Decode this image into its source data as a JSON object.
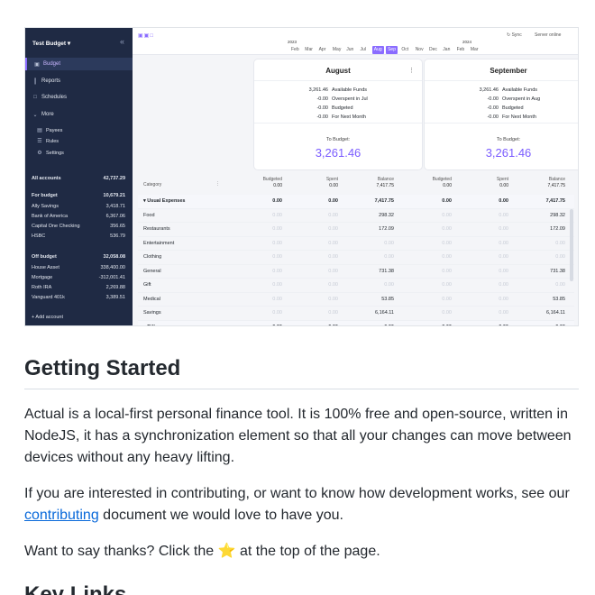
{
  "screenshot": {
    "sidebar": {
      "budget_title": "Test Budget ▾",
      "collapse_icon": "«",
      "nav": [
        {
          "icon": "wallet-icon",
          "glyph": "▣",
          "label": "Budget"
        },
        {
          "icon": "bar-chart-icon",
          "glyph": "┃",
          "label": "Reports"
        },
        {
          "icon": "calendar-icon",
          "glyph": "□",
          "label": "Schedules"
        },
        {
          "icon": "chevron-down-icon",
          "glyph": "⌄",
          "label": "More"
        },
        {
          "icon": "payees-icon",
          "glyph": "▤",
          "label": "Payees"
        },
        {
          "icon": "rules-icon",
          "glyph": "☰",
          "label": "Rules"
        },
        {
          "icon": "gear-icon",
          "glyph": "⚙",
          "label": "Settings"
        }
      ],
      "all_accounts": {
        "name": "All accounts",
        "amount": "42,737.29"
      },
      "for_budget": {
        "name": "For budget",
        "amount": "10,679.21"
      },
      "budget_accounts": [
        {
          "name": "Ally Savings",
          "amount": "3,418.71"
        },
        {
          "name": "Bank of America",
          "amount": "6,367.06"
        },
        {
          "name": "Capital One Checking",
          "amount": "356.65"
        },
        {
          "name": "HSBC",
          "amount": "536.79"
        }
      ],
      "off_budget": {
        "name": "Off budget",
        "amount": "32,058.08"
      },
      "off_accounts": [
        {
          "name": "House Asset",
          "amount": "338,400.00"
        },
        {
          "name": "Mortgage",
          "amount": "-312,001.41"
        },
        {
          "name": "Roth IRA",
          "amount": "2,269.88"
        },
        {
          "name": "Vanguard 401k",
          "amount": "3,389.51"
        }
      ],
      "add_account": "+  Add account"
    },
    "topbar": {
      "icons": "▣▣□",
      "year1": "2023",
      "year2": "2024",
      "months": [
        "Feb",
        "Mar",
        "Apr",
        "May",
        "Jun",
        "Jul",
        "Aug",
        "Sep",
        "Oct",
        "Nov",
        "Dec",
        "Jan",
        "Feb",
        "Mar"
      ],
      "sync": "↻ Sync",
      "server": "Server online"
    },
    "cards": [
      {
        "month": "August",
        "lines": [
          {
            "num": "3,261.46",
            "label": "Available Funds"
          },
          {
            "num": "-0.00",
            "label": "Overspent in Jul"
          },
          {
            "num": "-0.00",
            "label": "Budgeted"
          },
          {
            "num": "-0.00",
            "label": "For Next Month"
          }
        ],
        "to_budget_label": "To Budget:",
        "to_budget_value": "3,261.46"
      },
      {
        "month": "September",
        "lines": [
          {
            "num": "3,261.46",
            "label": "Available Funds"
          },
          {
            "num": "-0.00",
            "label": "Overspent in Aug"
          },
          {
            "num": "-0.00",
            "label": "Budgeted"
          },
          {
            "num": "-0.00",
            "label": "For Next Month"
          }
        ],
        "to_budget_label": "To Budget:",
        "to_budget_value": "3,261.46"
      }
    ],
    "grid": {
      "category_header": "Category",
      "col_headers": [
        {
          "name": "Budgeted",
          "value": "0.00"
        },
        {
          "name": "Spent",
          "value": "0.00"
        },
        {
          "name": "Balance",
          "value": "7,417.75"
        },
        {
          "name": "Budgeted",
          "value": "0.00"
        },
        {
          "name": "Spent",
          "value": "0.00"
        },
        {
          "name": "Balance",
          "value": "7,417.75"
        }
      ],
      "rows": [
        {
          "name": "▾ Usual Expenses",
          "group": true,
          "vals": [
            "0.00",
            "0.00",
            "7,417.75",
            "0.00",
            "0.00",
            "7,417.75"
          ]
        },
        {
          "name": "Food",
          "group": false,
          "vals": [
            "0.00",
            "0.00",
            "298.32",
            "0.00",
            "0.00",
            "298.32"
          ]
        },
        {
          "name": "Restaurants",
          "group": false,
          "vals": [
            "0.00",
            "0.00",
            "172.09",
            "0.00",
            "0.00",
            "172.09"
          ]
        },
        {
          "name": "Entertainment",
          "group": false,
          "vals": [
            "0.00",
            "0.00",
            "0.00",
            "0.00",
            "0.00",
            "0.00"
          ]
        },
        {
          "name": "Clothing",
          "group": false,
          "vals": [
            "0.00",
            "0.00",
            "0.00",
            "0.00",
            "0.00",
            "0.00"
          ]
        },
        {
          "name": "General",
          "group": false,
          "vals": [
            "0.00",
            "0.00",
            "731.38",
            "0.00",
            "0.00",
            "731.38"
          ]
        },
        {
          "name": "Gift",
          "group": false,
          "vals": [
            "0.00",
            "0.00",
            "0.00",
            "0.00",
            "0.00",
            "0.00"
          ]
        },
        {
          "name": "Medical",
          "group": false,
          "vals": [
            "0.00",
            "0.00",
            "53.85",
            "0.00",
            "0.00",
            "53.85"
          ]
        },
        {
          "name": "Savings",
          "group": false,
          "vals": [
            "0.00",
            "0.00",
            "6,164.11",
            "0.00",
            "0.00",
            "6,164.11"
          ]
        },
        {
          "name": "▸ Bills",
          "group": true,
          "vals": [
            "0.00",
            "0.00",
            "0.00",
            "0.00",
            "0.00",
            "0.00"
          ]
        }
      ]
    }
  },
  "article": {
    "heading1": "Getting Started",
    "p1": "Actual is a local-first personal finance tool. It is 100% free and open-source, written in NodeJS, it has a synchronization element so that all your changes can move between devices without any heavy lifting.",
    "p2_before": "If you are interested in contributing, or want to know how development works, see our ",
    "p2_link": "contributing",
    "p2_after": " document we would love to have you.",
    "p3_before": "Want to say thanks? Click the ",
    "p3_star": "⭐",
    "p3_after": " at the top of the page.",
    "heading2": "Key Links"
  },
  "colors": {
    "accent": "#8a6cff",
    "sidebar": "#1f2a44",
    "link": "#0969da"
  }
}
